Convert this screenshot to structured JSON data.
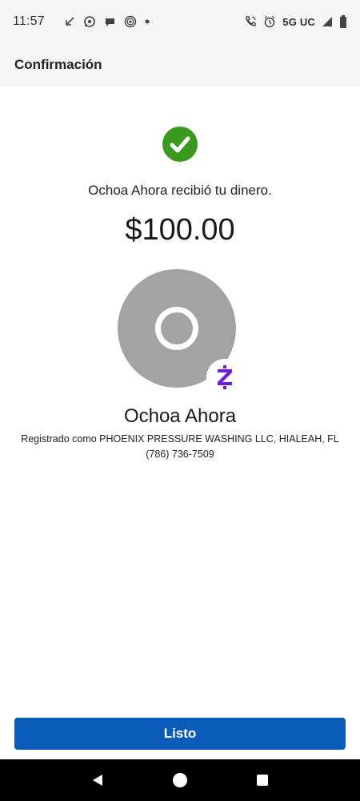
{
  "status_bar": {
    "time": "11:57",
    "network": "5G UC",
    "icons_left": [
      "missed-call-arrow-icon",
      "whatsapp-icon",
      "chat-bubble-icon",
      "fingerprint-app-icon",
      "dot-icon"
    ],
    "icons_right": [
      "wifi-calling-icon",
      "alarm-icon",
      "signal-icon",
      "battery-icon"
    ]
  },
  "header": {
    "title": "Confirmación"
  },
  "confirmation": {
    "message": "Ochoa Ahora recibió tu dinero.",
    "amount": "$100.00",
    "status_color": "#3a9a1f"
  },
  "recipient": {
    "name": "Ochoa Ahora",
    "registered_as": "Registrado como PHOENIX PRESSURE WASHING LLC, HIALEAH, FL",
    "phone": "(786) 736-7509",
    "badge_color": "#6d1ed4"
  },
  "actions": {
    "done_label": "Listo",
    "done_color": "#0a5cb8"
  },
  "nav_bar": {
    "buttons": [
      "back-icon",
      "home-icon",
      "recents-icon"
    ]
  }
}
